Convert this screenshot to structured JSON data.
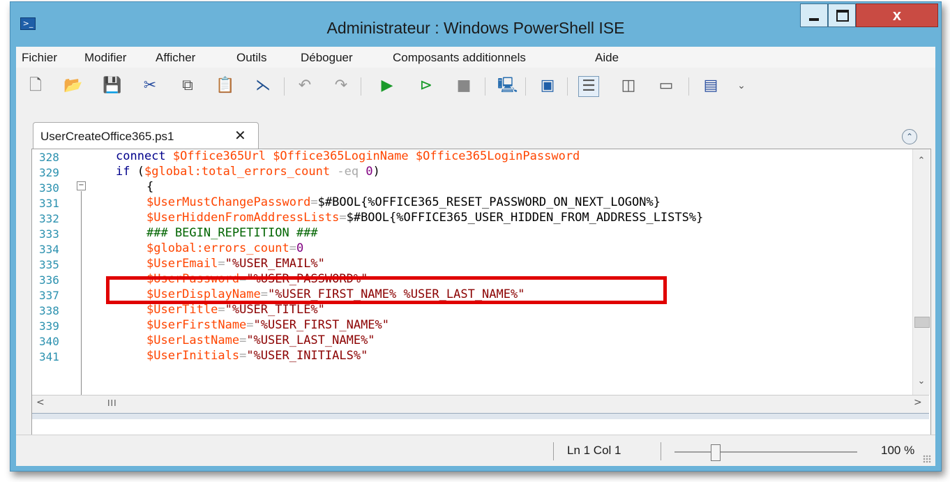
{
  "window": {
    "title": "Administrateur : Windows PowerShell ISE",
    "close_glyph": "x"
  },
  "menu": {
    "items": [
      "Fichier",
      "Modifier",
      "Afficher",
      "Outils",
      "Déboguer",
      "Composants additionnels",
      "Aide"
    ]
  },
  "toolbar": {
    "icons": [
      "new-icon",
      "open-icon",
      "save-icon",
      "cut-icon",
      "copy-icon",
      "paste-icon",
      "clear-console-icon",
      "undo-icon",
      "redo-icon",
      "run-icon",
      "run-selection-icon",
      "stop-icon",
      "remote-powershell-icon",
      "powershell-icon",
      "layout-top-icon",
      "layout-right-icon",
      "layout-max-icon",
      "commands-icon",
      "overflow-icon"
    ]
  },
  "tab": {
    "label": "UserCreateOffice365.ps1",
    "close_glyph": "✕"
  },
  "editor": {
    "line_numbers": [
      "328",
      "329",
      "330",
      "331",
      "332",
      "333",
      "334",
      "335",
      "336",
      "337",
      "338",
      "339",
      "340",
      "341"
    ],
    "lines": {
      "l328_kw": "connect",
      "l328_vars": "$Office365Url $Office365LoginName $Office365LoginPassword",
      "l329_kw": "if",
      "l329_open": "(",
      "l329_var": "$global:total_errors_count",
      "l329_op": "-eq",
      "l329_num": "0",
      "l329_close": ")",
      "l330_brace": "{",
      "l331_var": "$UserMustChangePassword",
      "l331_op": "=",
      "l331_rest": "$#BOOL{%OFFICE365_RESET_PASSWORD_ON_NEXT_LOGON%}",
      "l332_var": "$UserHiddenFromAddressLists",
      "l332_op": "=",
      "l332_rest": "$#BOOL{%OFFICE365_USER_HIDDEN_FROM_ADDRESS_LISTS%}",
      "l333_cmt": "### BEGIN_REPETITION ###",
      "l334_var": "$global:errors_count",
      "l334_op": "=",
      "l334_num": "0",
      "l335_var": "$UserEmail",
      "l335_op": "=",
      "l335_str": "\"%USER_EMAIL%\"",
      "l336_var": "$UserPassword",
      "l336_op": "=",
      "l336_str": "\"%USER_PASSWORD%\"",
      "l337_var": "$UserDisplayName",
      "l337_op": "=",
      "l337_str": "\"%USER_FIRST_NAME% %USER_LAST_NAME%\"",
      "l338_var": "$UserTitle",
      "l338_op": "=",
      "l338_str": "\"%USER_TITLE%\"",
      "l339_var": "$UserFirstName",
      "l339_op": "=",
      "l339_str": "\"%USER_FIRST_NAME%\"",
      "l340_var": "$UserLastName",
      "l340_op": "=",
      "l340_str": "\"%USER_LAST_NAME%\"",
      "l341_var": "$UserInitials",
      "l341_op": "=",
      "l341_str": "\"%USER_INITIALS%\""
    },
    "fold_glyph": "−",
    "collapse_glyph": "⌃",
    "scroll_up": "⌃",
    "scroll_down": "⌄",
    "scroll_left": "<",
    "scroll_right": ">",
    "hscroll_grip": "III"
  },
  "status": {
    "position": "Ln 1  Col 1",
    "zoom": "100 %"
  },
  "colors": {
    "keyword": "#00008b",
    "variable": "#ff4500",
    "string": "#8b0000",
    "comment": "#006400",
    "number": "#800080",
    "highlight_box": "#e00000"
  }
}
